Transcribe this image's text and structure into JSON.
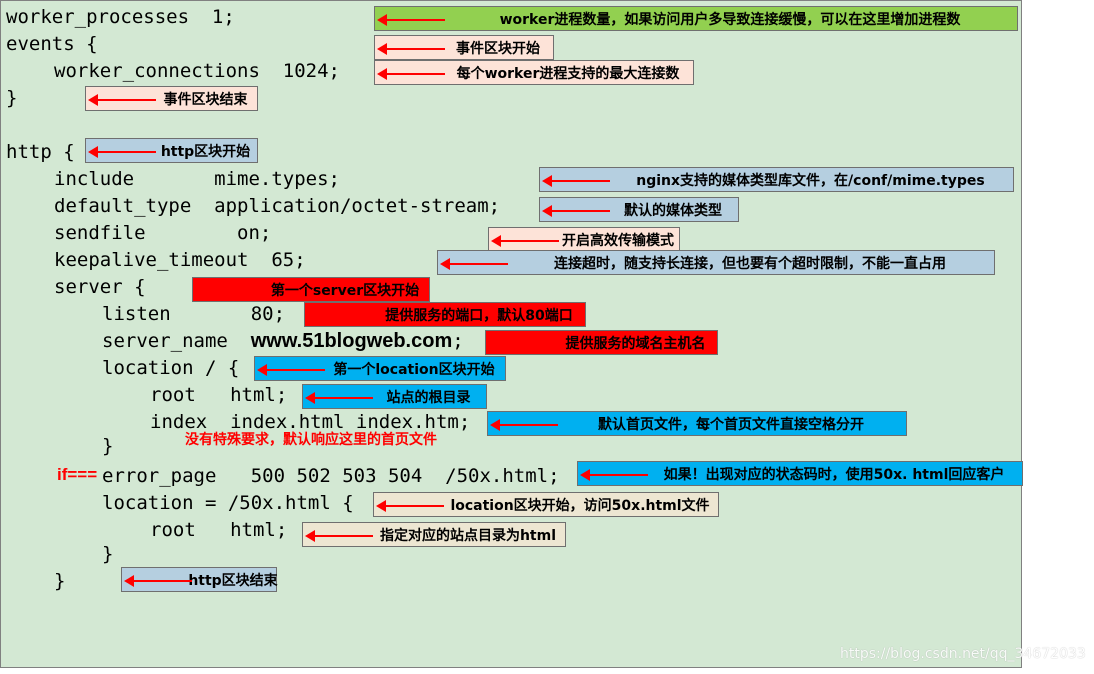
{
  "code": {
    "l1": "worker_processes  1;",
    "l2": "events {",
    "l3": "worker_connections  1024;",
    "l4": "}",
    "l5": "http {",
    "l6": "include       mime.types;",
    "l7": "default_type  application/octet-stream;",
    "l8": "sendfile        on;",
    "l9": "keepalive_timeout  65;",
    "l10": "server {",
    "l11": "listen       80;",
    "l12_prefix": "server_name  ",
    "l12_domain": "www.51blogweb.com",
    "l12_suffix": ";",
    "l13": "location / {",
    "l14": "root   html;",
    "l15": "index  index.html index.htm;",
    "l16": "}",
    "l17_if": "if===",
    "l17": "error_page   500 502 503 504  /50x.html;",
    "l18": "location = /50x.html {",
    "l19": "root   html;",
    "l20": "}",
    "l21": "}"
  },
  "notes": {
    "worker_processes": "worker进程数量，如果访问用户多导致连接缓慢，可以在这里增加进程数",
    "events_start": "事件区块开始",
    "worker_connections": "每个worker进程支持的最大连接数",
    "events_end": "事件区块结束",
    "http_start": "http区块开始",
    "mime_types": "nginx支持的媒体类型库文件，在/conf/mime.types",
    "default_type": "默认的媒体类型",
    "sendfile": "开启高效传输模式",
    "keepalive": "连接超时，随支持长连接，但也要有个超时限制，不能一直占用",
    "server_start": "第一个server区块开始",
    "listen": "提供服务的端口，默认80端口",
    "server_name": "提供服务的域名主机名",
    "location_start": "第一个location区块开始",
    "root": "站点的根目录",
    "index": "默认首页文件，每个首页文件直接空格分开",
    "index_note": "没有特殊要求，默认响应这里的首页文件",
    "error_page": "如果！出现对应的状态码时，使用50x. html回应客户",
    "location_50x": "location区块开始，访问50x.html文件",
    "root_50x": "指定对应的站点目录为html",
    "http_end": "http区块结束"
  },
  "watermark": "https://blog.csdn.net/qq_34672033",
  "colors": {
    "panel": "#d3e8d3",
    "arrow": "#ff0000",
    "green": "#92d050",
    "pink": "#fde3d8",
    "blue": "#b5cfe0",
    "red": "#ff0000",
    "cyan": "#00b0f0",
    "tan": "#ede6d2"
  }
}
